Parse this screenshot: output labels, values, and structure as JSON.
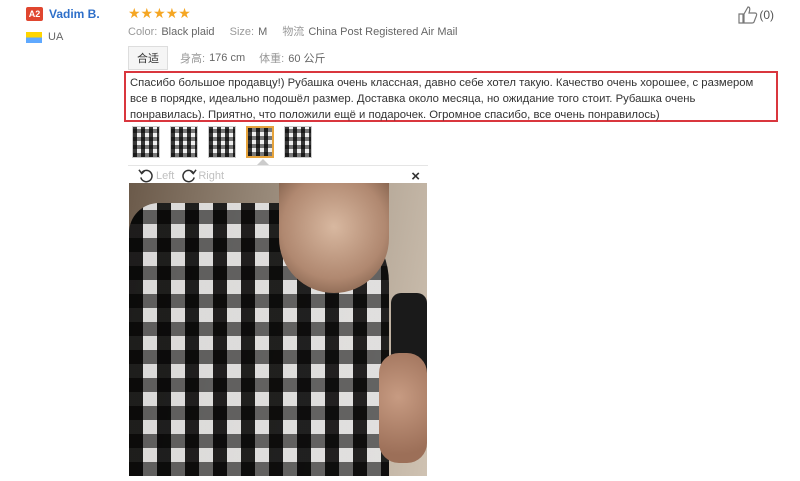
{
  "user": {
    "level": "A2",
    "name": "Vadim B.",
    "country": "UA"
  },
  "rating": {
    "stars": "★★★★★",
    "value": 5,
    "max": 5
  },
  "meta": {
    "color_label": "Color:",
    "color_value": "Black plaid",
    "size_label": "Size:",
    "size_value": "M",
    "shipping_label": "物流",
    "shipping_value": "China Post Registered Air Mail"
  },
  "sku": {
    "fit_tag": "合适",
    "height_label": "身高:",
    "height_value": "176 cm",
    "weight_label": "体重:",
    "weight_value": "60 公斤"
  },
  "helpful": {
    "count": "(0)"
  },
  "review": {
    "text": "Спасибо большое продавцу!) Рубашка очень классная, давно себе хотел такую. Качество очень хорошее, с размером все в порядке, идеально подошёл размер. Доставка около месяца, но ожидание того стоит. Рубашка очень понравилась). Приятно, что положили ещё и подарочек. Огромное спасибо, все очень понравилось)"
  },
  "viewer": {
    "rotate_left": "Left",
    "rotate_right": "Right",
    "close": "×",
    "thumbnails": 5,
    "selected_thumbnail": 4
  },
  "colors": {
    "accent": "#f5a623",
    "link": "#2e6fc9",
    "highlight_border": "#d9363e",
    "badge": "#e0462f"
  }
}
